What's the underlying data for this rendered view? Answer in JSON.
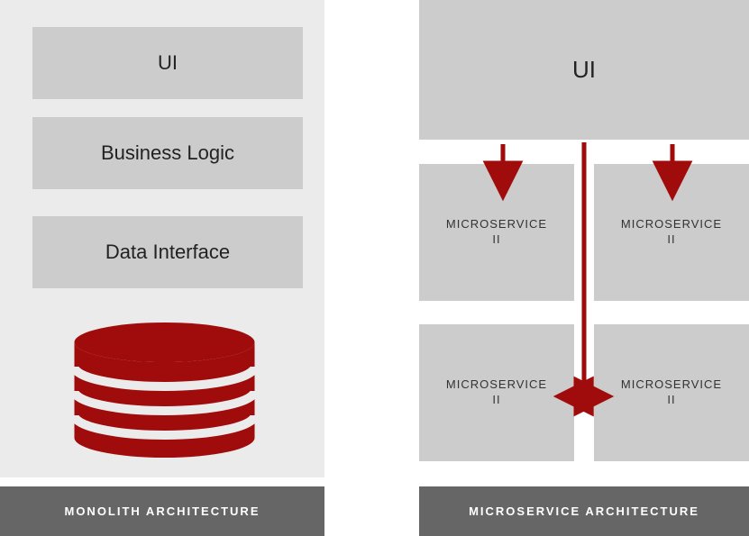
{
  "colors": {
    "panel_bg": "#ebebeb",
    "box_bg": "#cccccc",
    "footer_bg": "#666666",
    "accent": "#a00b0b"
  },
  "left": {
    "box1": "UI",
    "box2": "Business Logic",
    "box3": "Data Interface",
    "footer": "MONOLITH ARCHITECTURE"
  },
  "right": {
    "ui_box": "UI",
    "ms1_line1": "MICROSERVICE",
    "ms1_line2": "II",
    "ms2_line1": "MICROSERVICE",
    "ms2_line2": "II",
    "ms3_line1": "MICROSERVICE",
    "ms3_line2": "II",
    "ms4_line1": "MICROSERVICE",
    "ms4_line2": "II",
    "footer": "MICROSERVICE ARCHITECTURE"
  }
}
